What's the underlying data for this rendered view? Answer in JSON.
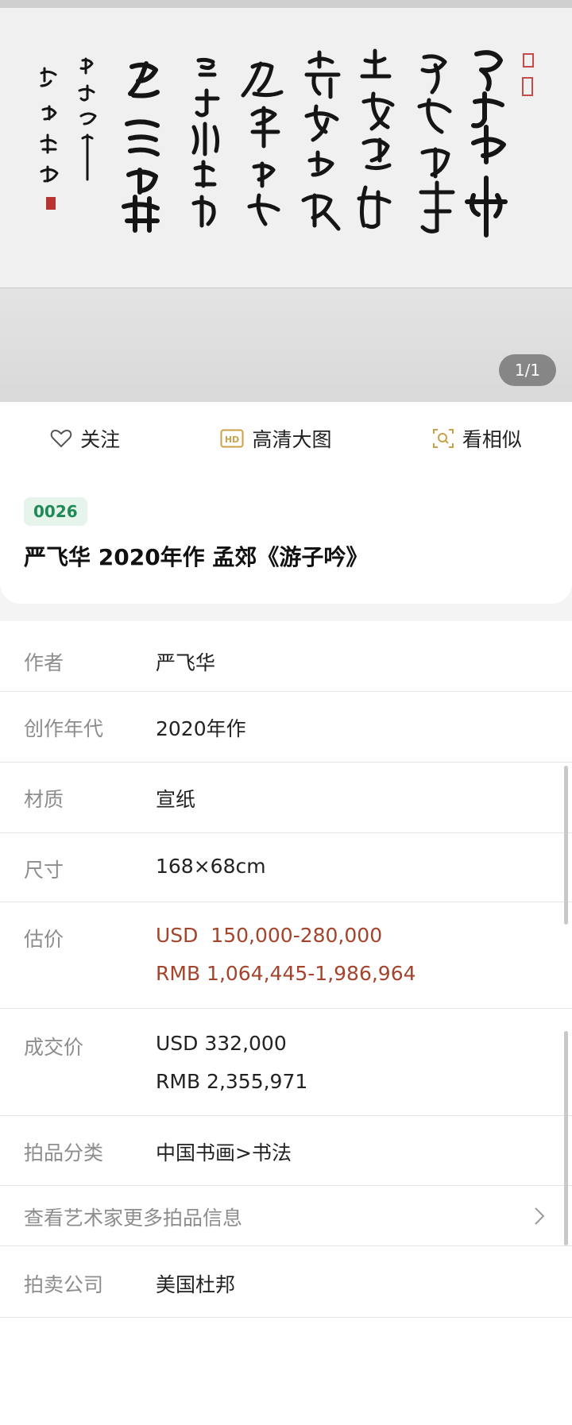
{
  "gallery": {
    "counter": "1/1",
    "calligraphy_columns": [
      "慈母手中",
      "线游子身",
      "上衣临行",
      "密缝意恐",
      "迟迟归谁",
      "言寸草心报",
      "得三春晖"
    ],
    "inscription": "庚子冬月",
    "signature": "严飞华书"
  },
  "actions": {
    "follow": "关注",
    "hd": "高清大图",
    "hd_badge": "HD",
    "similar": "看相似"
  },
  "lot": {
    "number": "0026",
    "title": "严飞华 2020年作 孟郊《游子吟》"
  },
  "details": {
    "author_label": "作者",
    "author_value": "严飞华",
    "year_label": "创作年代",
    "year_value": "2020年作",
    "material_label": "材质",
    "material_value": "宣纸",
    "size_label": "尺寸",
    "size_value": "168×68cm",
    "estimate_label": "估价",
    "estimate_usd": "USD  150,000-280,000",
    "estimate_rmb": "RMB 1,064,445-1,986,964",
    "sold_label": "成交价",
    "sold_usd": "USD 332,000",
    "sold_rmb": "RMB 2,355,971",
    "category_label": "拍品分类",
    "category_value": "中国书画>书法",
    "more_label": "查看艺术家更多拍品信息",
    "auction_label": "拍卖公司",
    "auction_value": "美国杜邦"
  },
  "colors": {
    "accent_green": "#1f8a55",
    "estimate_red": "#a4442c",
    "label_gray": "#8d8d8d"
  }
}
